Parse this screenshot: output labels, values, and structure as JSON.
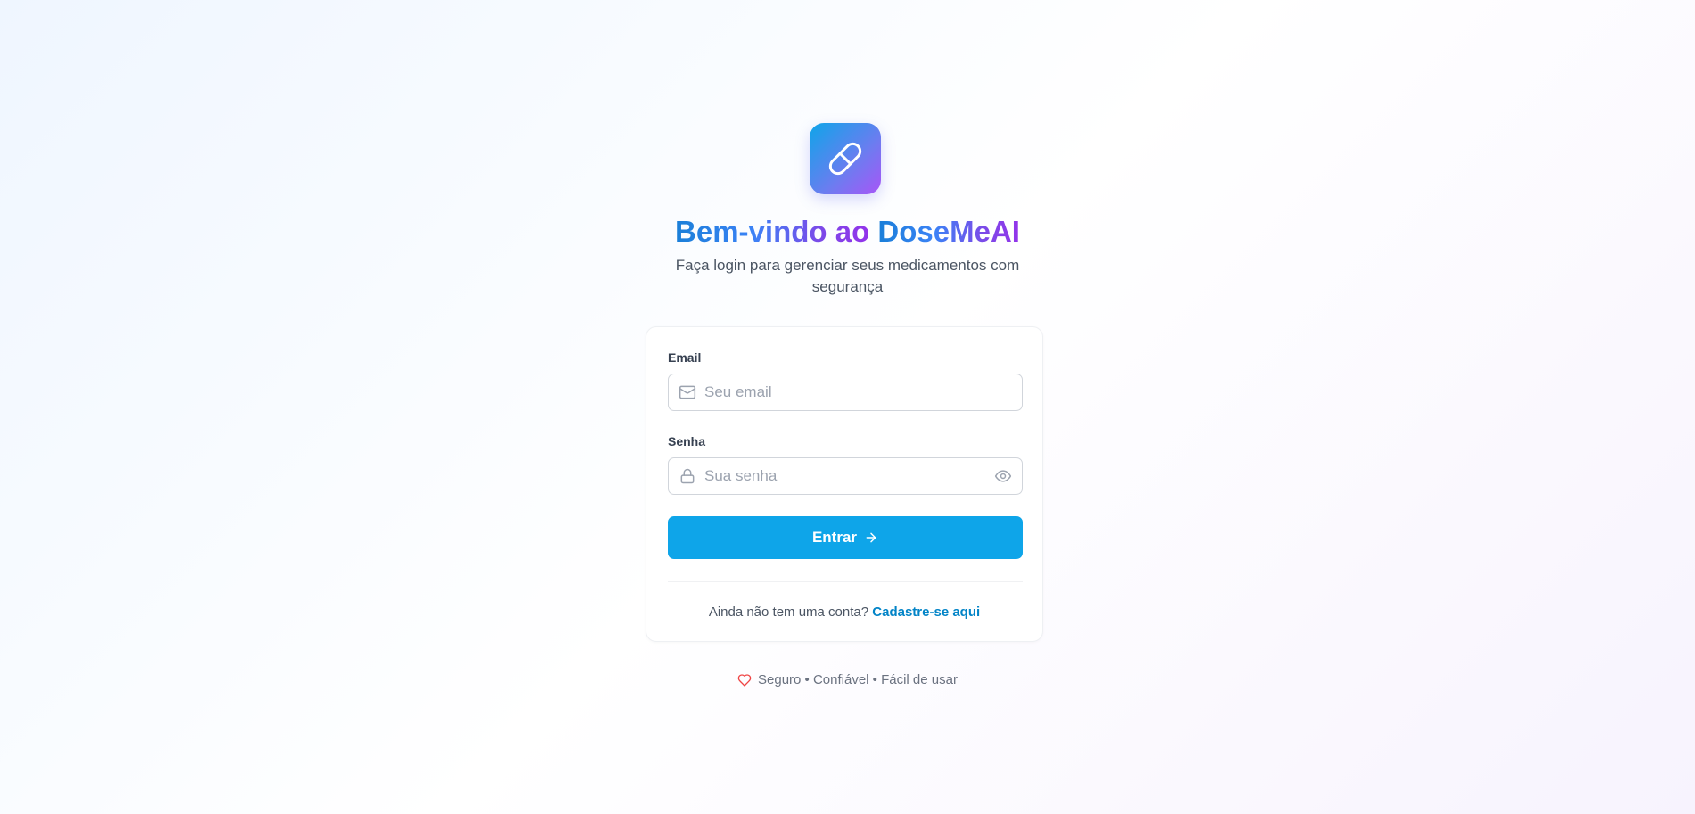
{
  "app": {
    "name": "DoseMeAI",
    "logo_icon": "pill-icon"
  },
  "header": {
    "title_prefix": "Bem-vindo ao",
    "title_brand": "DoseMeAI",
    "subtitle": "Faça login para gerenciar seus medicamentos com segurança"
  },
  "form": {
    "email": {
      "label": "Email",
      "placeholder": "Seu email",
      "value": "",
      "icon": "mail-icon"
    },
    "password": {
      "label": "Senha",
      "placeholder": "Sua senha",
      "value": "",
      "icon": "lock-icon",
      "toggle_icon": "eye-icon"
    },
    "submit_label": "Entrar",
    "submit_icon": "arrow-right-icon"
  },
  "signup": {
    "prompt": "Ainda não tem uma conta?",
    "link_label": "Cadastre-se aqui"
  },
  "footer": {
    "icon": "heart-icon",
    "text": "Seguro • Confiável • Fácil de usar"
  },
  "colors": {
    "primary": "#0ea5e9",
    "link": "#0284c7",
    "gradient_start": "#0ea5e9",
    "gradient_end": "#a855f7",
    "heart": "#ef4444"
  }
}
